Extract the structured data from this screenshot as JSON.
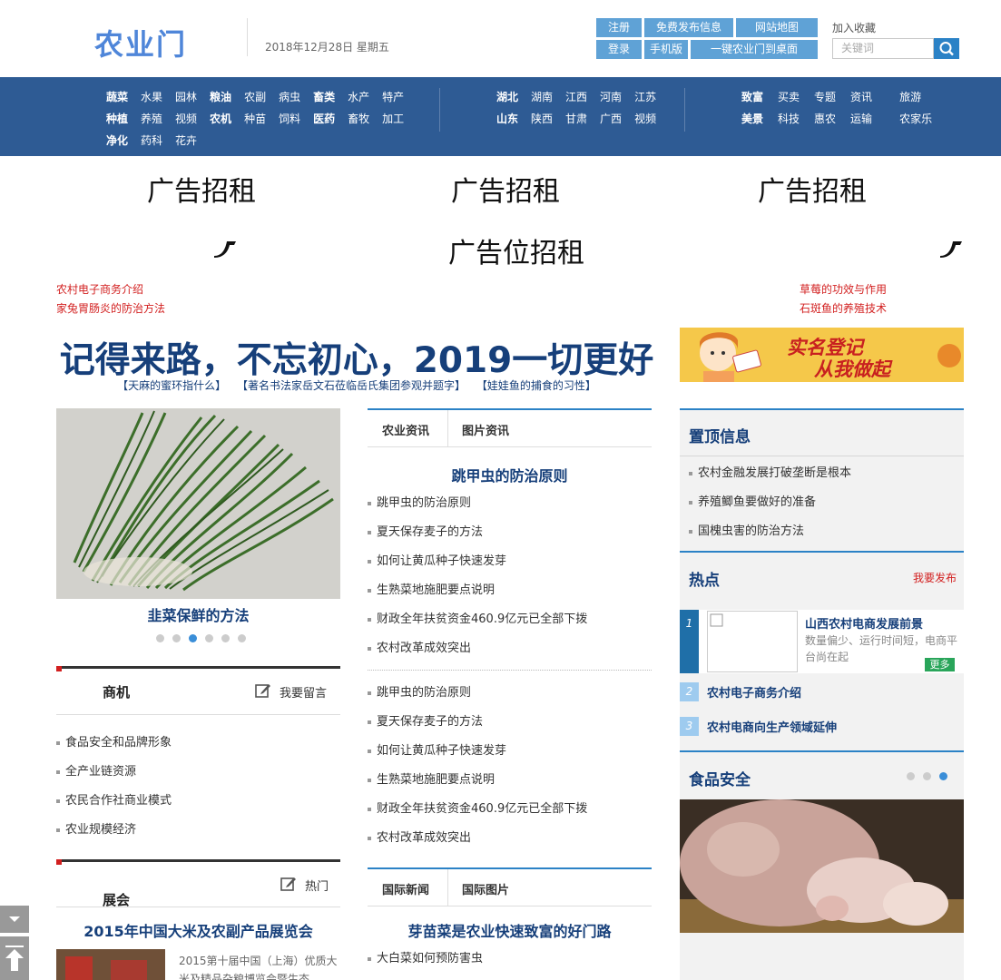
{
  "header": {
    "logo": "农业门",
    "date": "2018年12月28日 星期五",
    "top_links": [
      "注册",
      "免费发布信息",
      "网站地图",
      "登录",
      "手机版",
      "一键农业门到桌面"
    ],
    "favorite": "加入收藏",
    "search_placeholder": "关键词"
  },
  "nav": {
    "group1_rows": [
      [
        "蔬菜",
        "水果",
        "园林",
        "粮油",
        "农副",
        "病虫",
        "畜类",
        "水产",
        "特产"
      ],
      [
        "种植",
        "养殖",
        "视频",
        "农机",
        "种苗",
        "饲料",
        "医药",
        "畜牧",
        "加工"
      ],
      [
        "净化",
        "药科",
        "花卉"
      ]
    ],
    "group2_rows": [
      [
        "湖北",
        "湖南",
        "江西",
        "河南",
        "江苏"
      ],
      [
        "山东",
        "陕西",
        "甘肃",
        "广西",
        "视频"
      ]
    ],
    "group3_rows": [
      [
        "致富",
        "买卖",
        "专题",
        "资讯",
        "旅游"
      ],
      [
        "美景",
        "科技",
        "惠农",
        "运输",
        "农家乐"
      ]
    ]
  },
  "ads": {
    "banner1": "广告招租",
    "banner2": "广告招租",
    "banner3": "广告招租",
    "wide": "广告位招租"
  },
  "red_links_left": [
    "农村电子商务介绍",
    "家兔胃肠炎的防治方法"
  ],
  "red_links_right": [
    "草莓的功效与作用",
    "石斑鱼的养殖技术"
  ],
  "headline": {
    "title": "记得来路，不忘初心，2019一切更好",
    "subs": [
      "【天麻的蜜环指什么】",
      "【著名书法家岳文石莅临岳氏集团参观并题字】",
      "【娃娃鱼的捕食的习性】"
    ]
  },
  "banner_right": {
    "text1": "实名登记",
    "text2": "从我做起"
  },
  "slider": {
    "caption": "韭菜保鲜的方法",
    "dots": 6,
    "active": 2
  },
  "shangji": {
    "title": "商机",
    "action": "我要留言",
    "items": [
      "食品安全和品牌形象",
      "全产业链资源",
      "农民合作社商业模式",
      "农业规模经济"
    ]
  },
  "zhanhui": {
    "title": "展会",
    "action": "热门",
    "headline": "2015年中国大米及农副产品展览会",
    "desc_line1": "2015第十届中国（上海）优质大",
    "desc_line2": "米及精品杂粮博览会暨生态"
  },
  "news_tabs": {
    "tab1": "农业资讯",
    "tab2": "图片资讯",
    "headline": "跳甲虫的防治原则",
    "list1": [
      "跳甲虫的防治原则",
      "夏天保存麦子的方法",
      "如何让黄瓜种子快速发芽",
      "生熟菜地施肥要点说明",
      "财政全年扶贫资金460.9亿元已全部下拨",
      "农村改革成效突出"
    ],
    "list2": [
      "跳甲虫的防治原则",
      "夏天保存麦子的方法",
      "如何让黄瓜种子快速发芽",
      "生熟菜地施肥要点说明",
      "财政全年扶贫资金460.9亿元已全部下拨",
      "农村改革成效突出"
    ]
  },
  "intl_tabs": {
    "tab1": "国际新闻",
    "tab2": "国际图片",
    "headline": "芽苗菜是农业快速致富的好门路",
    "list": [
      "大白菜如何预防害虫"
    ]
  },
  "pinned": {
    "title": "置顶信息",
    "items": [
      "农村金融发展打破垄断是根本",
      "养殖鲫鱼要做好的准备",
      "国槐虫害的防治方法"
    ]
  },
  "hot": {
    "title": "热点",
    "action": "我要发布",
    "first_title": "山西农村电商发展前景",
    "first_desc1": "数量偏少、运行时间短，电商平",
    "first_desc2": "台尚在起",
    "more": "更多",
    "items": [
      {
        "num": "1",
        "title": "山西农村电商发展前景"
      },
      {
        "num": "2",
        "title": "农村电子商务介绍"
      },
      {
        "num": "3",
        "title": "农村电商向生产领域延伸"
      }
    ]
  },
  "food_safety": {
    "title": "食品安全",
    "dots": 3,
    "active": 2
  }
}
